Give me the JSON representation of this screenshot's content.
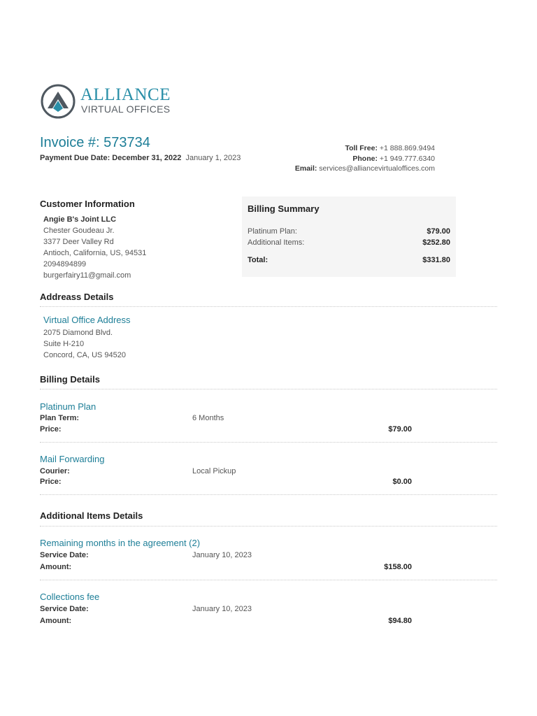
{
  "logo": {
    "icon": "alliance-mountain-logo-icon",
    "line1": "ALLIANCE",
    "line2": "VIRTUAL OFFICES",
    "colors": {
      "teal": "#2a8fa8",
      "dark": "#4f5860"
    }
  },
  "invoice": {
    "title": "Invoice #: 573734",
    "due_label": "Payment Due Date: December 31, 2022",
    "due_extra": "January 1, 2023"
  },
  "contact": {
    "toll_free_label": "Toll Free:",
    "toll_free": "+1 888.869.9494",
    "phone_label": "Phone:",
    "phone": "+1 949.777.6340",
    "email_label": "Email:",
    "email": "services@alliancevirtualoffices.com"
  },
  "customer": {
    "heading": "Customer Information",
    "company": "Angie B's Joint LLC",
    "contact": "Chester Goudeau Jr.",
    "street": "3377 Deer Valley Rd",
    "city": "Antioch, California, US, 94531",
    "phone": "2094894899",
    "email": "burgerfairy11@gmail.com"
  },
  "billing_summary": {
    "heading": "Billing Summary",
    "plan_label": "Platinum Plan:",
    "plan_value": "$79.00",
    "additional_label": "Additional Items:",
    "additional_value": "$252.80",
    "total_label": "Total:",
    "total_value": "$331.80"
  },
  "address_details": {
    "heading": "Addreass Details",
    "title": "Virtual Office Address",
    "line1": "2075 Diamond Blvd.",
    "line2": "Suite H-210",
    "line3": "Concord, CA, US 94520"
  },
  "billing_details": {
    "heading": "Billing Details",
    "items": [
      {
        "title": "Platinum Plan",
        "label1": "Plan Term:",
        "value1": "6 Months",
        "label2": "Price:",
        "amount": "$79.00"
      },
      {
        "title": "Mail Forwarding",
        "label1": "Courier:",
        "value1": "Local Pickup",
        "label2": "Price:",
        "amount": "$0.00"
      }
    ]
  },
  "additional_items": {
    "heading": "Additional Items Details",
    "items": [
      {
        "title": "Remaining months in the agreement (2)",
        "label1": "Service Date:",
        "value1": "January 10, 2023",
        "label2": "Amount:",
        "amount": "$158.00"
      },
      {
        "title": "Collections fee",
        "label1": "Service Date:",
        "value1": "January 10, 2023",
        "label2": "Amount:",
        "amount": "$94.80"
      }
    ]
  }
}
